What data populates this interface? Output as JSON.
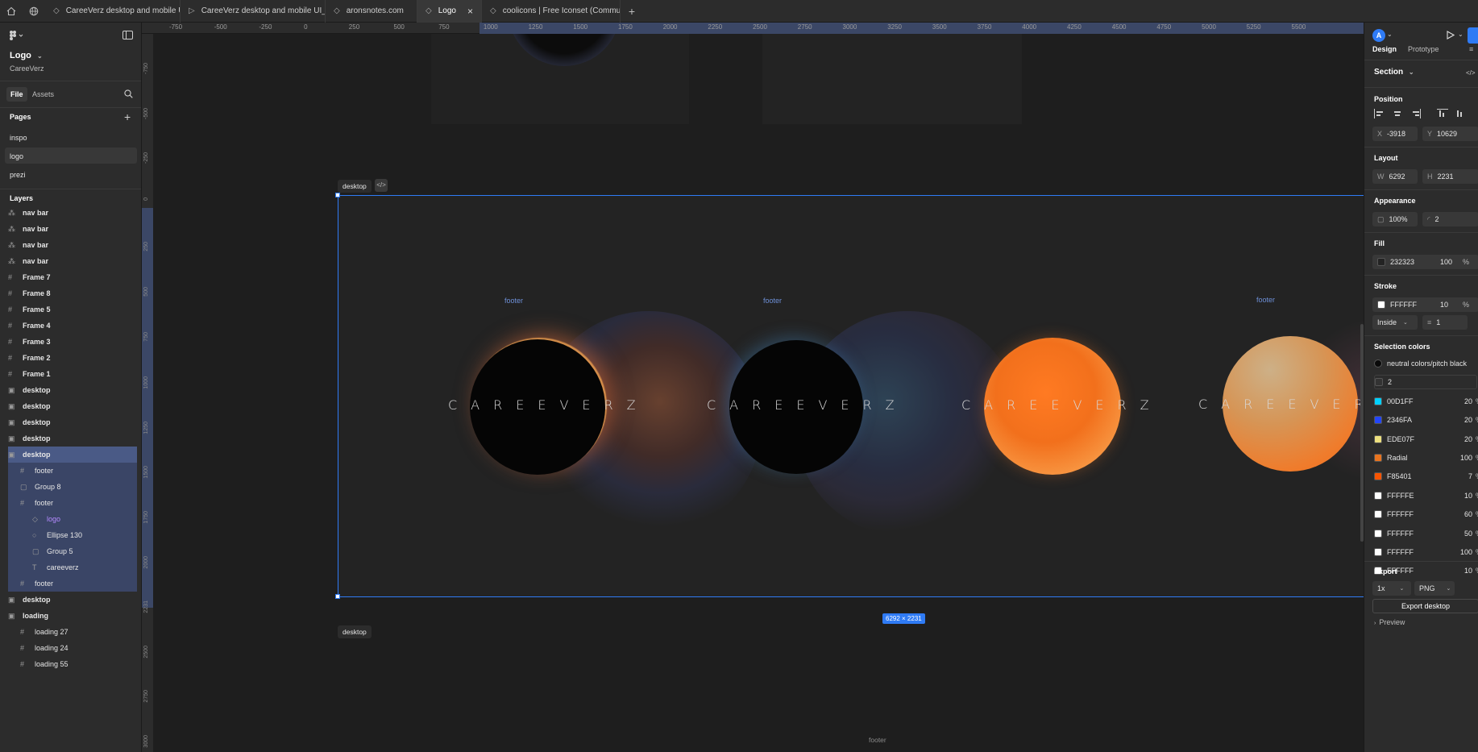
{
  "tabs": [
    {
      "label": "CareeVerz desktop and mobile UI_fin:",
      "icon": "figma-file-icon"
    },
    {
      "label": "CareeVerz desktop and mobile UI_fin:",
      "icon": "play-icon"
    },
    {
      "label": "aronsnotes.com",
      "icon": "figma-file-icon"
    },
    {
      "label": "Logo",
      "icon": "figma-file-icon",
      "active": true
    },
    {
      "label": "coolicons | Free Iconset (Community)",
      "icon": "figma-file-icon"
    }
  ],
  "file": {
    "name": "Logo",
    "team": "CareeVerz"
  },
  "left_tabs": {
    "file": "File",
    "assets": "Assets"
  },
  "pages": {
    "heading": "Pages",
    "items": [
      "inspo",
      "logo",
      "prezi"
    ],
    "selected": "logo"
  },
  "layers": {
    "heading": "Layers",
    "items": [
      {
        "label": "nav bar",
        "icon": "component-icon"
      },
      {
        "label": "nav bar",
        "icon": "component-icon"
      },
      {
        "label": "nav bar",
        "icon": "component-icon"
      },
      {
        "label": "nav bar",
        "icon": "component-icon"
      },
      {
        "label": "Frame 7",
        "icon": "frame-icon"
      },
      {
        "label": "Frame 8",
        "icon": "frame-icon"
      },
      {
        "label": "Frame 5",
        "icon": "frame-icon"
      },
      {
        "label": "Frame 4",
        "icon": "frame-icon"
      },
      {
        "label": "Frame 3",
        "icon": "frame-icon"
      },
      {
        "label": "Frame 2",
        "icon": "frame-icon"
      },
      {
        "label": "Frame 1",
        "icon": "frame-icon"
      },
      {
        "label": "desktop",
        "icon": "section-icon"
      },
      {
        "label": "desktop",
        "icon": "section-icon"
      },
      {
        "label": "desktop",
        "icon": "section-icon"
      },
      {
        "label": "desktop",
        "icon": "section-icon"
      },
      {
        "label": "desktop",
        "icon": "section-icon",
        "selected": true
      },
      {
        "label": "footer",
        "icon": "frame-icon",
        "child": 1
      },
      {
        "label": "Group 8",
        "icon": "group-icon",
        "child": 1
      },
      {
        "label": "footer",
        "icon": "frame-icon",
        "child": 1
      },
      {
        "label": "logo",
        "icon": "diamond-icon",
        "child": 2,
        "accent": true
      },
      {
        "label": "Ellipse 130",
        "icon": "ellipse-icon",
        "child": 2
      },
      {
        "label": "Group 5",
        "icon": "group-icon",
        "child": 2
      },
      {
        "label": "careeverz",
        "icon": "text-icon",
        "child": 2
      },
      {
        "label": "footer",
        "icon": "frame-icon",
        "child": 1
      },
      {
        "label": "desktop",
        "icon": "section-icon"
      },
      {
        "label": "loading",
        "icon": "section-icon"
      },
      {
        "label": "loading 27",
        "icon": "frame-icon",
        "child": 1
      },
      {
        "label": "loading 24",
        "icon": "frame-icon",
        "child": 1
      },
      {
        "label": "loading 55",
        "icon": "frame-icon",
        "child": 1
      }
    ]
  },
  "ruler_top": [
    "-750",
    "-500",
    "-250",
    "0",
    "250",
    "500",
    "750",
    "1000",
    "1250",
    "1500",
    "1750",
    "2000",
    "2250",
    "2500",
    "2750",
    "3000",
    "3250",
    "3500",
    "3750",
    "4000",
    "4250",
    "4500",
    "4750",
    "5000",
    "5250",
    "5500"
  ],
  "ruler_left": [
    "-750",
    "-500",
    "-250",
    "0",
    "250",
    "500",
    "750",
    "1000",
    "1250",
    "1500",
    "1750",
    "2000",
    "2231",
    "2500",
    "2750",
    "3000"
  ],
  "canvas": {
    "section_label_top": "desktop",
    "section_label_bottom": "desktop",
    "dimensions_badge": "6292 × 2231",
    "footer_labels": [
      "footer",
      "footer",
      "footer",
      "footer"
    ],
    "bottom_footer_label": "footer",
    "logo_text": "CAREEVERZ",
    "selection_color": "#2f7bf5"
  },
  "right": {
    "avatar": "A",
    "tabs": {
      "design": "Design",
      "prototype": "Prototype"
    },
    "section_type": "Section",
    "position": {
      "heading": "Position",
      "x_label": "X",
      "x": "-3918",
      "y_label": "Y",
      "y": "10629"
    },
    "layout": {
      "heading": "Layout",
      "w_label": "W",
      "w": "6292",
      "h_label": "H",
      "h": "2231"
    },
    "appearance": {
      "heading": "Appearance",
      "opacity": "100%",
      "radius": "2"
    },
    "fill": {
      "heading": "Fill",
      "hex": "232323",
      "opacity": "100",
      "unit": "%"
    },
    "stroke": {
      "heading": "Stroke",
      "hex": "FFFFFF",
      "opacity": "10",
      "unit": "%",
      "position": "Inside",
      "weight": "1"
    },
    "selection_colors": {
      "heading": "Selection colors",
      "items": [
        {
          "name": "neutral colors/pitch black",
          "color": "#0a0a0a"
        },
        {
          "name": "2",
          "color": "#333333"
        },
        {
          "name": "00D1FF",
          "value": "20",
          "color": "#00D1FF"
        },
        {
          "name": "2346FA",
          "value": "20",
          "color": "#2346FA"
        },
        {
          "name": "EDE07F",
          "value": "20",
          "color": "#EDE07F"
        },
        {
          "name": "Radial",
          "value": "100",
          "color": "#e8741f"
        },
        {
          "name": "F85401",
          "value": "7",
          "color": "#F85401"
        },
        {
          "name": "FFFFFE",
          "value": "10",
          "color": "#FFFFFE"
        },
        {
          "name": "FFFFFF",
          "value": "60",
          "color": "#FFFFFF"
        },
        {
          "name": "FFFFFF",
          "value": "50",
          "color": "#FFFFFF"
        },
        {
          "name": "FFFFFF",
          "value": "100",
          "color": "#FFFFFF"
        },
        {
          "name": "FFFFFF",
          "value": "10",
          "color": "#FFFFFF"
        }
      ],
      "unit": "%"
    },
    "export": {
      "heading": "Export",
      "scale": "1x",
      "format": "PNG",
      "button": "Export desktop",
      "preview": "Preview"
    }
  }
}
